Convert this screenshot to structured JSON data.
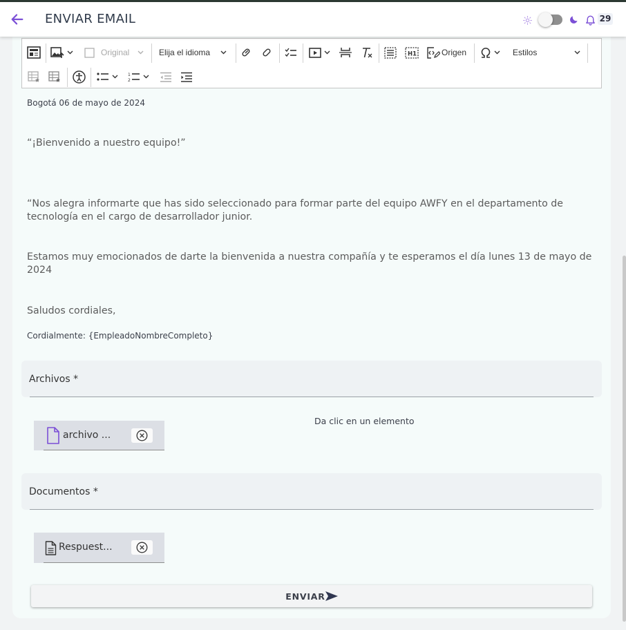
{
  "app": {
    "title": "ENVIAR EMAIL",
    "notifications_count": "29",
    "accent_color": "#7b4fd6"
  },
  "toolbar": {
    "image_size_option": "Original",
    "language_select": "Elija el idioma",
    "source_button": "Origen",
    "styles_select": "Estilos",
    "icons": [
      "template-icon",
      "image-upload-icon",
      "image-size-icon",
      "link-icon",
      "unlink-icon",
      "todo-list-icon",
      "media-embed-icon",
      "page-break-icon",
      "remove-format-icon",
      "select-all-icon",
      "heading-icon",
      "source-icon",
      "special-characters-icon",
      "insert-table-icon",
      "table-properties-icon",
      "accessibility-icon",
      "bulleted-list-icon",
      "numbered-list-icon",
      "outdent-icon",
      "indent-icon"
    ]
  },
  "email": {
    "date_line": "Bogotá 06 de mayo de 2024",
    "greeting": "“¡Bienvenido a nuestro equipo!”",
    "paragraph1": "“Nos alegra informarte  que has sido seleccionado para formar parte del equipo AWFY en el departamento de tecnología en el cargo de desarrollador junior.",
    "paragraph2": "Estamos muy emocionados de darte la bienvenida a nuestra compañía y te esperamos el día lunes 13 de mayo de 2024",
    "closing": "Saludos cordiales,",
    "signature": "Cordialmente: {EmpleadoNombreCompleto}"
  },
  "attachments": {
    "files_label": "Archivos *",
    "file_name": "archivo ...",
    "hint": "Da clic en un elemento",
    "documents_label": "Documentos *",
    "document_name": "Respuest..."
  },
  "actions": {
    "send_label": "ENVIAR"
  }
}
